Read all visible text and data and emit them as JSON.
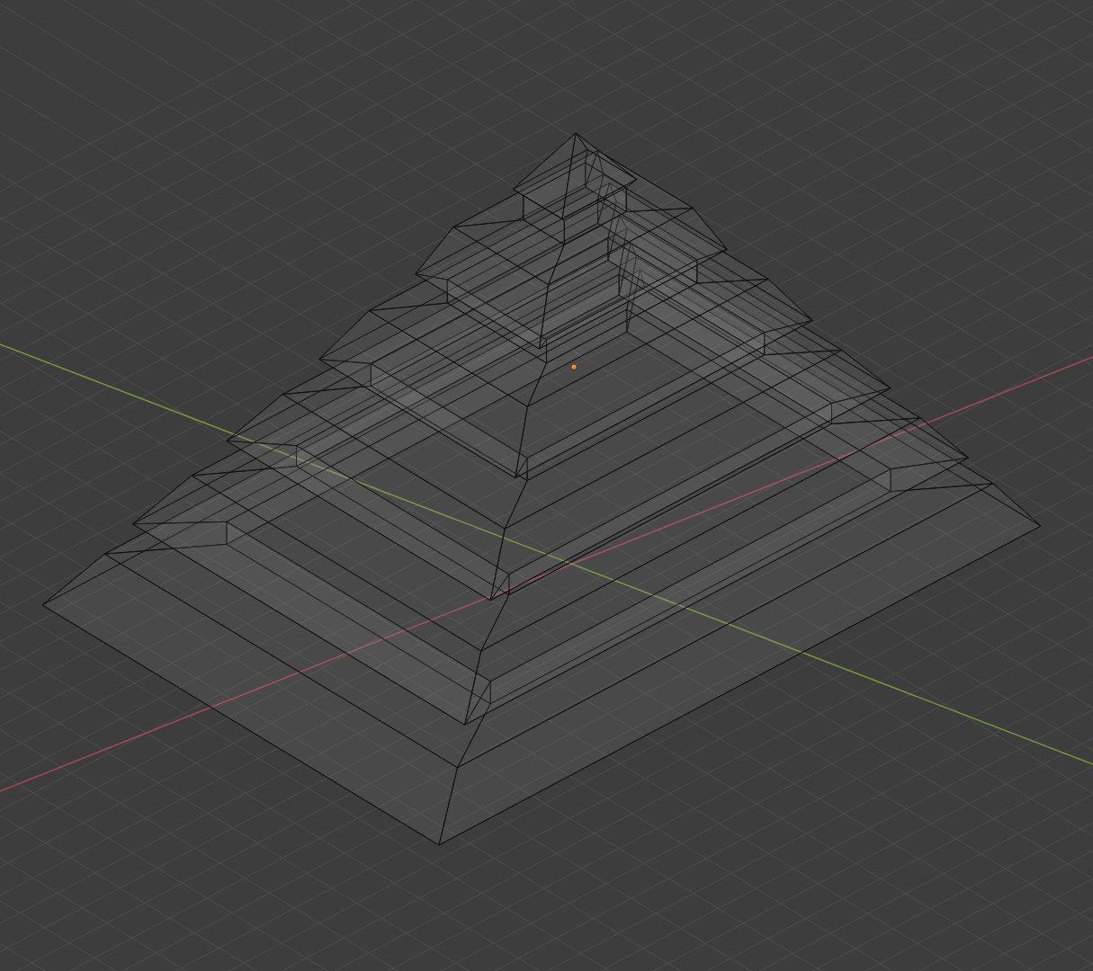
{
  "viewport": {
    "xray": true,
    "show_grid": true,
    "show_axes": true,
    "show_origin": true
  }
}
